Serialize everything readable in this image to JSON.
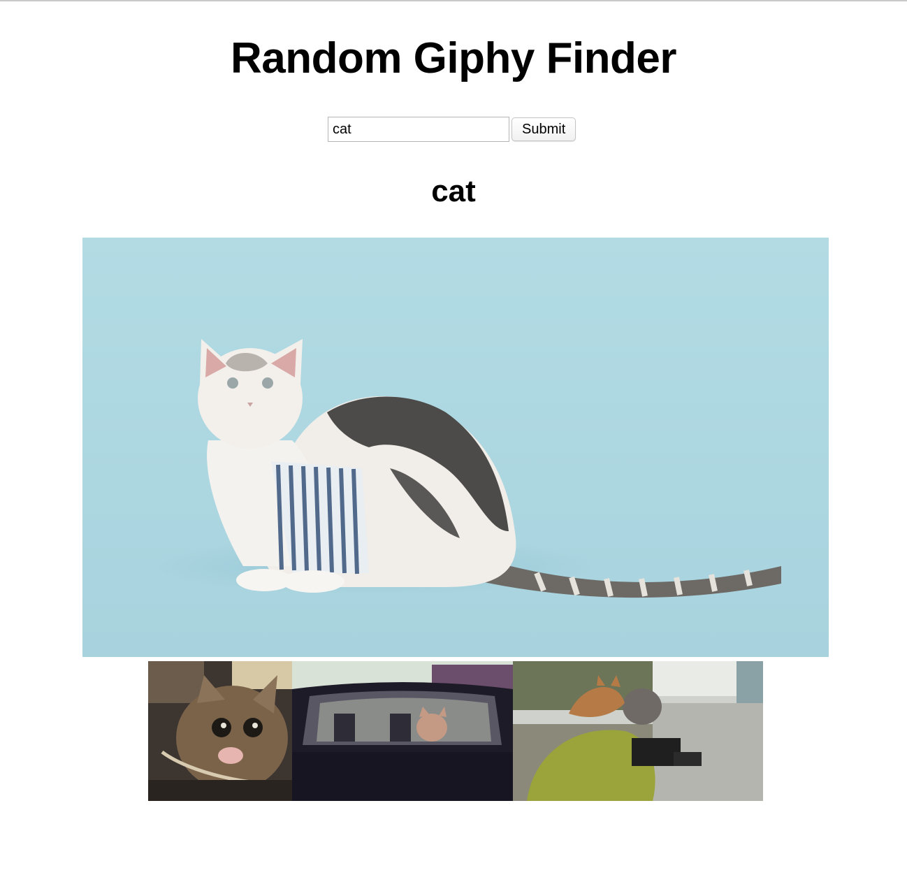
{
  "header": {
    "title": "Random Giphy Finder"
  },
  "search": {
    "value": "cat",
    "submit_label": "Submit"
  },
  "results": {
    "query_heading": "cat",
    "main_gif": {
      "description": "cat-gif"
    },
    "thumbnails": [
      {
        "description": "cat-gif-thumbnail"
      },
      {
        "description": "cat-gif-thumbnail"
      },
      {
        "description": "cat-gif-thumbnail"
      }
    ]
  }
}
